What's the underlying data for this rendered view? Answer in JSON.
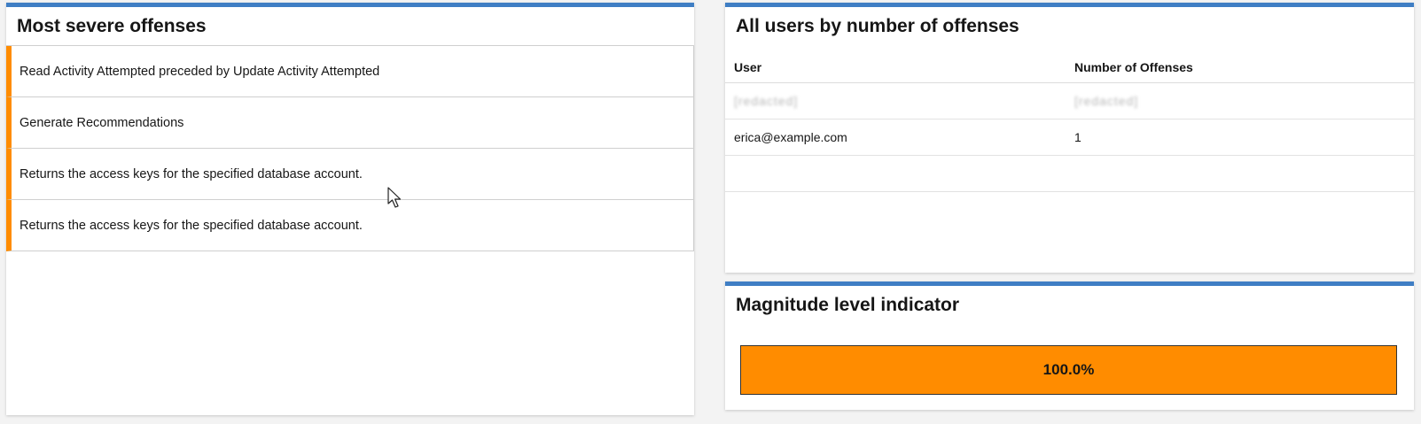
{
  "most_severe_offenses": {
    "title": "Most severe offenses",
    "items": [
      {
        "label": "Read Activity Attempted preceded by Update Activity Attempted"
      },
      {
        "label": "Generate Recommendations"
      },
      {
        "label": "Returns the access keys for the specified database account."
      },
      {
        "label": "Returns the access keys for the specified database account."
      }
    ],
    "severity_color": "#ff8c00"
  },
  "users_by_offenses": {
    "title": "All users by number of offenses",
    "columns": [
      "User",
      "Number of Offenses"
    ],
    "rows": [
      {
        "user": "[redacted]",
        "count": "[redacted]",
        "redacted": true
      },
      {
        "user": "erica@example.com",
        "count": "1",
        "redacted": false
      },
      {
        "user": "",
        "count": "",
        "redacted": true
      }
    ]
  },
  "magnitude_indicator": {
    "title": "Magnitude level indicator",
    "value_label": "100.0%",
    "fill_fraction": 1.0,
    "fill_color": "#ff8c00"
  },
  "accent_color": "#3f7ec4"
}
